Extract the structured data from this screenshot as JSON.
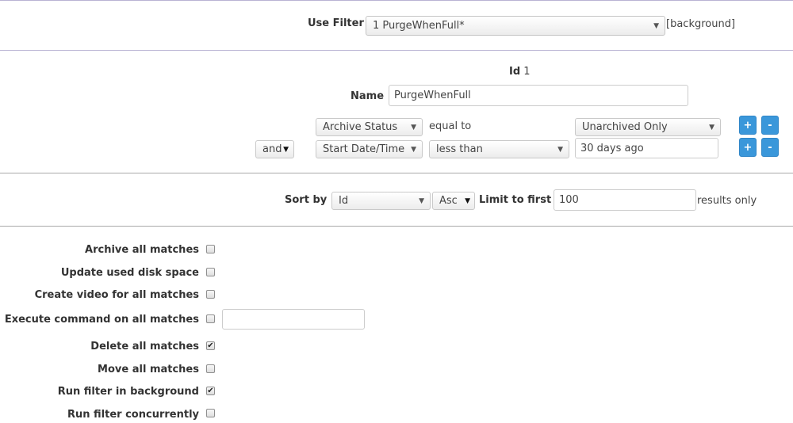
{
  "filter_bar": {
    "label": "Use Filter",
    "selected": "1 PurgeWhenFull*",
    "suffix": "[background]"
  },
  "filter": {
    "id_label": "Id",
    "id_value": "1",
    "name_label": "Name",
    "name_value": "PurgeWhenFull",
    "terms": [
      {
        "attr": "Archive Status",
        "op": "equal to",
        "value": "Unarchived Only",
        "add": "+",
        "remove": "-"
      },
      {
        "conj": "and",
        "attr": "Start Date/Time",
        "op": "less than",
        "value": "30 days ago",
        "add": "+",
        "remove": "-"
      }
    ]
  },
  "sort": {
    "label": "Sort by",
    "field": "Id",
    "dir": "Asc",
    "limit_label": "Limit to first",
    "limit_value": "100",
    "limit_suffix": "results only"
  },
  "actions": [
    {
      "label": "Archive all matches",
      "checked": false
    },
    {
      "label": "Update used disk space",
      "checked": false
    },
    {
      "label": "Create video for all matches",
      "checked": false
    },
    {
      "label": "Execute command on all matches",
      "checked": false,
      "command": ""
    },
    {
      "label": "Delete all matches",
      "checked": true
    },
    {
      "label": "Move all matches",
      "checked": false
    },
    {
      "label": "Run filter in background",
      "checked": true
    },
    {
      "label": "Run filter concurrently",
      "checked": false
    }
  ],
  "icons": {
    "dropdown": "triangle-down",
    "checkmark": "check"
  },
  "colors": {
    "button_blue": "#3a97da",
    "divider_purple": "#b9b3d3",
    "divider_gray": "#a9a9a9"
  }
}
